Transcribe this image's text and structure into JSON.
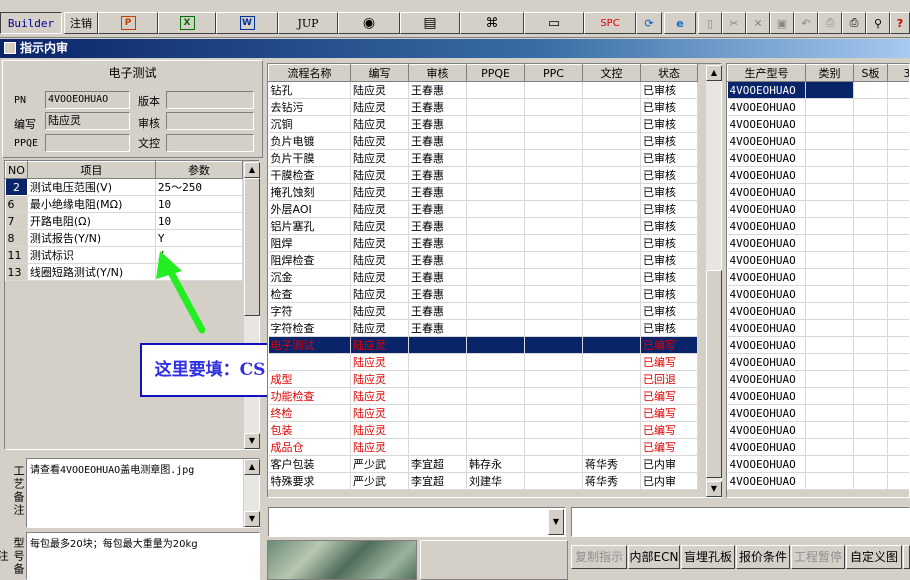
{
  "toolbar": {
    "builder_label": "Builder",
    "cancel_label": "注销",
    "jup_label": "JUP",
    "spc_label": "SPC",
    "icons": [
      "ppt-icon",
      "excel-icon",
      "word-icon",
      "jup-icon",
      "eye-icon",
      "database-icon",
      "network-icon",
      "computer-icon",
      "spc-icon",
      "refresh-icon",
      "ie-icon",
      "new-icon",
      "cut-icon",
      "close-icon",
      "save-icon",
      "undo-icon",
      "preview-icon",
      "print-icon",
      "find-icon",
      "help-icon"
    ]
  },
  "window": {
    "title": "指示内审"
  },
  "header": {
    "section_title": "电子测试",
    "pn_label": "PN",
    "pn_value": "4VOOEOHUAO",
    "version_label": "版本",
    "version_value": "",
    "writer_label": "编写",
    "writer_value": "陆应灵",
    "reviewer_label": "审核",
    "reviewer_value": "",
    "ppqe_label": "PPQE",
    "ppqe_value": "",
    "doc_label": "文控",
    "doc_value": ""
  },
  "params": {
    "columns": [
      "NO",
      "项目",
      "参数"
    ],
    "rows": [
      {
        "no": "2",
        "item": "测试电压范围(V)",
        "value": "25～250"
      },
      {
        "no": "6",
        "item": "最小绝缘电阻(MΩ)",
        "value": "10"
      },
      {
        "no": "7",
        "item": "开路电阻(Ω)",
        "value": "10"
      },
      {
        "no": "8",
        "item": "测试报告(Y/N)",
        "value": "Y"
      },
      {
        "no": "11",
        "item": "测试标识",
        "value": "/"
      },
      {
        "no": "13",
        "item": "线圈短路测试(Y/N)",
        "value": "N"
      }
    ]
  },
  "annotation": {
    "text": "这里要填：CS",
    "color": "#22ee22"
  },
  "notes": {
    "process_label": "工艺备注",
    "process_value": "请查看4VOOEOHUAO盖电测章图.jpg",
    "type_label": "型号备注",
    "type_value": "每包最多20块；每包最大重量为20kg"
  },
  "process_table": {
    "columns": [
      "流程名称",
      "编写",
      "审核",
      "PPQE",
      "PPC",
      "文控",
      "状态"
    ],
    "rows": [
      {
        "name": "钻孔",
        "writer": "陆应灵",
        "reviewer": "王春惠",
        "ppqe": "",
        "ppc": "",
        "doc": "",
        "status": "已审核",
        "style": "normal"
      },
      {
        "name": "去钻污",
        "writer": "陆应灵",
        "reviewer": "王春惠",
        "ppqe": "",
        "ppc": "",
        "doc": "",
        "status": "已审核",
        "style": "normal"
      },
      {
        "name": "沉铜",
        "writer": "陆应灵",
        "reviewer": "王春惠",
        "ppqe": "",
        "ppc": "",
        "doc": "",
        "status": "已审核",
        "style": "normal"
      },
      {
        "name": "负片电镀",
        "writer": "陆应灵",
        "reviewer": "王春惠",
        "ppqe": "",
        "ppc": "",
        "doc": "",
        "status": "已审核",
        "style": "normal"
      },
      {
        "name": "负片干膜",
        "writer": "陆应灵",
        "reviewer": "王春惠",
        "ppqe": "",
        "ppc": "",
        "doc": "",
        "status": "已审核",
        "style": "normal"
      },
      {
        "name": "干膜检查",
        "writer": "陆应灵",
        "reviewer": "王春惠",
        "ppqe": "",
        "ppc": "",
        "doc": "",
        "status": "已审核",
        "style": "normal"
      },
      {
        "name": "掩孔蚀刻",
        "writer": "陆应灵",
        "reviewer": "王春惠",
        "ppqe": "",
        "ppc": "",
        "doc": "",
        "status": "已审核",
        "style": "normal"
      },
      {
        "name": "外层AOI",
        "writer": "陆应灵",
        "reviewer": "王春惠",
        "ppqe": "",
        "ppc": "",
        "doc": "",
        "status": "已审核",
        "style": "normal"
      },
      {
        "name": "铝片塞孔",
        "writer": "陆应灵",
        "reviewer": "王春惠",
        "ppqe": "",
        "ppc": "",
        "doc": "",
        "status": "已审核",
        "style": "normal"
      },
      {
        "name": "阻焊",
        "writer": "陆应灵",
        "reviewer": "王春惠",
        "ppqe": "",
        "ppc": "",
        "doc": "",
        "status": "已审核",
        "style": "normal"
      },
      {
        "name": "阻焊检查",
        "writer": "陆应灵",
        "reviewer": "王春惠",
        "ppqe": "",
        "ppc": "",
        "doc": "",
        "status": "已审核",
        "style": "normal"
      },
      {
        "name": "沉金",
        "writer": "陆应灵",
        "reviewer": "王春惠",
        "ppqe": "",
        "ppc": "",
        "doc": "",
        "status": "已审核",
        "style": "normal"
      },
      {
        "name": "检查",
        "writer": "陆应灵",
        "reviewer": "王春惠",
        "ppqe": "",
        "ppc": "",
        "doc": "",
        "status": "已审核",
        "style": "normal"
      },
      {
        "name": "字符",
        "writer": "陆应灵",
        "reviewer": "王春惠",
        "ppqe": "",
        "ppc": "",
        "doc": "",
        "status": "已审核",
        "style": "normal"
      },
      {
        "name": "字符检查",
        "writer": "陆应灵",
        "reviewer": "王春惠",
        "ppqe": "",
        "ppc": "",
        "doc": "",
        "status": "已审核",
        "style": "normal"
      },
      {
        "name": "电子测试",
        "writer": "陆应灵",
        "reviewer": "",
        "ppqe": "",
        "ppc": "",
        "doc": "",
        "status": "已编写",
        "style": "selected"
      },
      {
        "name": "",
        "writer": "陆应灵",
        "reviewer": "",
        "ppqe": "",
        "ppc": "",
        "doc": "",
        "status": "已编写",
        "style": "red"
      },
      {
        "name": "成型",
        "writer": "陆应灵",
        "reviewer": "",
        "ppqe": "",
        "ppc": "",
        "doc": "",
        "status": "已回退",
        "style": "red"
      },
      {
        "name": "功能检查",
        "writer": "陆应灵",
        "reviewer": "",
        "ppqe": "",
        "ppc": "",
        "doc": "",
        "status": "已编写",
        "style": "red"
      },
      {
        "name": "终检",
        "writer": "陆应灵",
        "reviewer": "",
        "ppqe": "",
        "ppc": "",
        "doc": "",
        "status": "已编写",
        "style": "red"
      },
      {
        "name": "包装",
        "writer": "陆应灵",
        "reviewer": "",
        "ppqe": "",
        "ppc": "",
        "doc": "",
        "status": "已编写",
        "style": "red"
      },
      {
        "name": "成品仓",
        "writer": "陆应灵",
        "reviewer": "",
        "ppqe": "",
        "ppc": "",
        "doc": "",
        "status": "已编写",
        "style": "red"
      },
      {
        "name": "客户包装",
        "writer": "严少武",
        "reviewer": "李宜超",
        "ppqe": "韩存永",
        "ppc": "",
        "doc": "蒋华秀",
        "status": "已内审",
        "style": "normal"
      },
      {
        "name": "特殊要求",
        "writer": "严少武",
        "reviewer": "李宜超",
        "ppqe": "刘建华",
        "ppc": "",
        "doc": "蒋华秀",
        "status": "已内审",
        "style": "normal"
      }
    ]
  },
  "model_table": {
    "columns": [
      "生产型号",
      "类别",
      "S板",
      "3"
    ],
    "rows": [
      "4VOOEOHUAO",
      "4VOOEOHUAO",
      "4VOOEOHUAO",
      "4VOOEOHUAO",
      "4VOOEOHUAO",
      "4VOOEOHUAO",
      "4VOOEOHUAO",
      "4VOOEOHUAO",
      "4VOOEOHUAO",
      "4VOOEOHUAO",
      "4VOOEOHUAO",
      "4VOOEOHUAO",
      "4VOOEOHUAO",
      "4VOOEOHUAO",
      "4VOOEOHUAO",
      "4VOOEOHUAO",
      "4VOOEOHUAO",
      "4VOOEOHUAO",
      "4VOOEOHUAO",
      "4VOOEOHUAO",
      "4VOOEOHUAO",
      "4VOOEOHUAO",
      "4VOOEOHUAO",
      "4VOOEOHUAO"
    ]
  },
  "bottom_buttons": {
    "copy_label": "复制指示",
    "ecn_label": "内部ECN",
    "blind_hole_label": "盲埋孔板",
    "quote_label": "报价条件",
    "pause_label": "工程暂停",
    "custom_label": "自定义图"
  }
}
